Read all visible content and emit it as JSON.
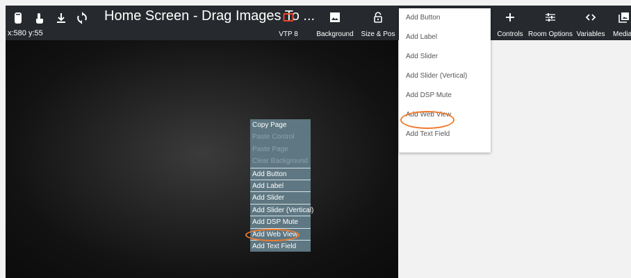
{
  "toolbar": {
    "title": "Home Screen - Drag Images To ...",
    "coords": "x:580 y:55",
    "icons": [
      "phone-icon",
      "touch-hand-icon",
      "download-icon",
      "sync-icon"
    ],
    "buttons": [
      {
        "label": "VTP 8",
        "icon": "tablet-outline-icon",
        "icon_color": "#e8452c"
      },
      {
        "label": "Background",
        "icon": "image-icon"
      },
      {
        "label": "Size & Pos",
        "icon": "lock-icon"
      },
      {
        "label": "Controls",
        "icon": "plus-icon"
      },
      {
        "label": "Room Options",
        "icon": "sliders-icon"
      },
      {
        "label": "Variables",
        "icon": "code-icon"
      },
      {
        "label": "Media",
        "icon": "media-icon"
      }
    ]
  },
  "context_menu": {
    "items": [
      {
        "label": "Copy Page",
        "enabled": true
      },
      {
        "label": "Paste Control",
        "enabled": false
      },
      {
        "label": "Paste Page",
        "enabled": false
      },
      {
        "label": "Clear Background",
        "enabled": false
      },
      {
        "label": "Add Button",
        "enabled": true
      },
      {
        "label": "Add Label",
        "enabled": true
      },
      {
        "label": "Add Slider",
        "enabled": true
      },
      {
        "label": "Add Slider (Vertical)",
        "enabled": true
      },
      {
        "label": "Add DSP Mute",
        "enabled": true
      },
      {
        "label": "Add Web View",
        "enabled": true,
        "highlighted": true
      },
      {
        "label": "Add Text Field",
        "enabled": true
      }
    ]
  },
  "controls_dropdown": {
    "items": [
      {
        "label": "Add Button"
      },
      {
        "label": "Add Label"
      },
      {
        "label": "Add Slider"
      },
      {
        "label": "Add Slider (Vertical)"
      },
      {
        "label": "Add DSP Mute"
      },
      {
        "label": "Add Web View",
        "highlighted": true
      },
      {
        "label": "Add Text Field"
      }
    ]
  },
  "colors": {
    "toolbar_bg": "#262a2e",
    "menu_bg": "#5e7782",
    "highlight_ring": "#f07b2e",
    "device_icon": "#e8452c"
  }
}
